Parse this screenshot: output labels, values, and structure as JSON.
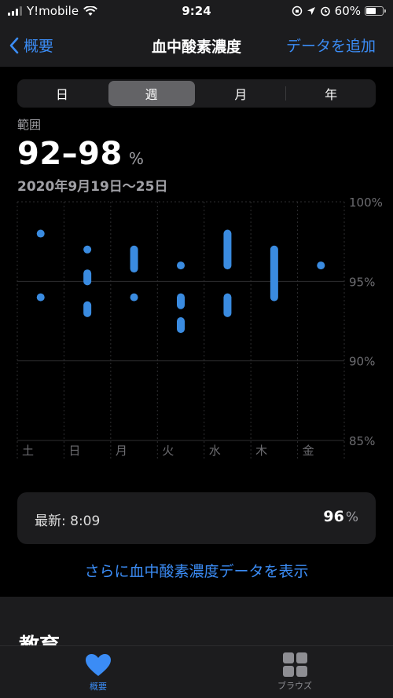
{
  "status_bar": {
    "carrier": "Y!mobile",
    "time": "9:24",
    "battery": "60%",
    "battery_level": 0.6
  },
  "nav": {
    "back_label": "概要",
    "title": "血中酸素濃度",
    "add_label": "データを追加"
  },
  "segments": [
    {
      "label": "日",
      "selected": false
    },
    {
      "label": "週",
      "selected": true
    },
    {
      "label": "月",
      "selected": false
    },
    {
      "label": "年",
      "selected": false
    }
  ],
  "summary": {
    "range_label": "範囲",
    "range_value": "92–98",
    "unit": "%",
    "date_range": "2020年9月19日〜25日"
  },
  "chart_data": {
    "type": "scatter",
    "categories": [
      "土",
      "日",
      "月",
      "火",
      "水",
      "木",
      "金"
    ],
    "y_ticks": [
      "100%",
      "95%",
      "90%",
      "85%"
    ],
    "ylim": [
      85,
      100
    ],
    "grid": true,
    "color": "#3a8be0",
    "series": [
      {
        "category": "土",
        "ranges": [
          [
            98,
            98
          ],
          [
            94,
            94
          ]
        ]
      },
      {
        "category": "日",
        "ranges": [
          [
            97,
            97
          ],
          [
            95.5,
            95
          ],
          [
            93.5,
            93
          ]
        ]
      },
      {
        "category": "月",
        "ranges": [
          [
            97,
            95.8
          ],
          [
            94,
            94
          ]
        ]
      },
      {
        "category": "火",
        "ranges": [
          [
            96,
            96
          ],
          [
            94,
            93.5
          ],
          [
            92.5,
            92
          ]
        ]
      },
      {
        "category": "水",
        "ranges": [
          [
            98,
            96
          ],
          [
            94,
            93
          ]
        ]
      },
      {
        "category": "木",
        "ranges": [
          [
            97,
            94
          ]
        ]
      },
      {
        "category": "金",
        "ranges": [
          [
            96,
            96
          ]
        ]
      }
    ]
  },
  "latest": {
    "label": "最新: 8:09",
    "value": "96",
    "unit": "%"
  },
  "show_more": "さらに血中酸素濃度データを表示",
  "education": {
    "heading": "教育"
  },
  "tab_bar": {
    "summary_label": "概要",
    "browse_label": "ブラウズ",
    "watermark": "スマホアップ"
  }
}
